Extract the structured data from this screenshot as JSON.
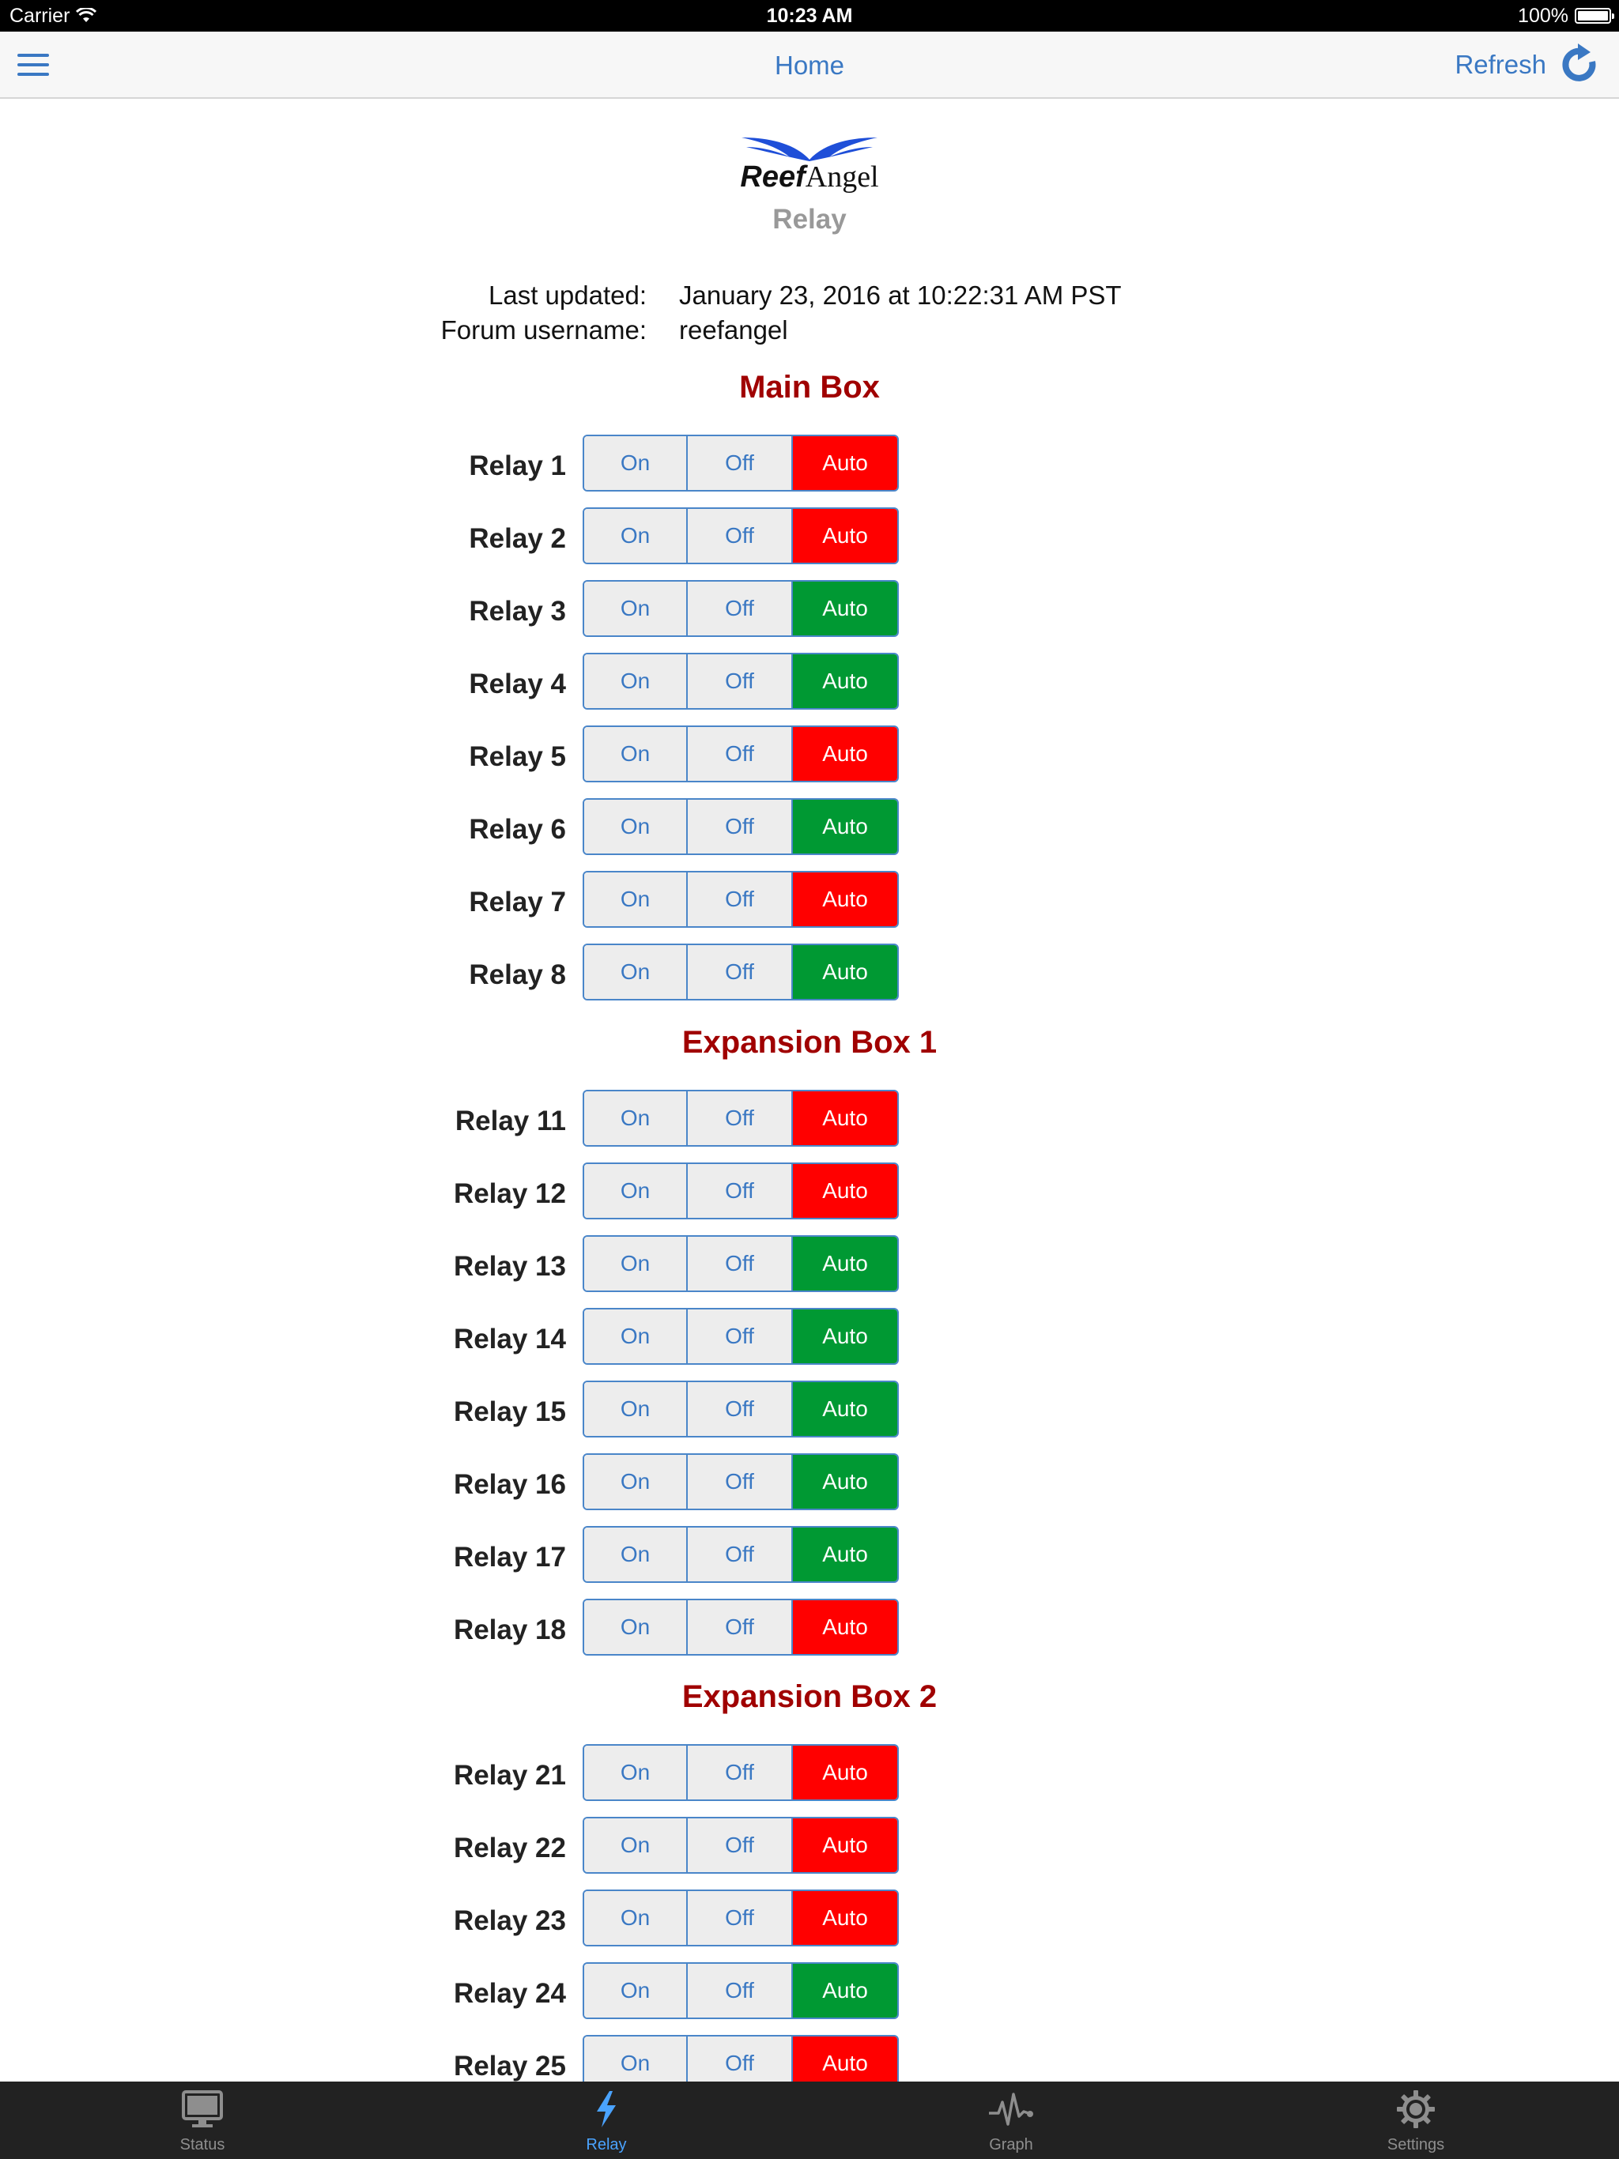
{
  "status_bar": {
    "carrier": "Carrier",
    "time": "10:23 AM",
    "battery": "100%"
  },
  "nav": {
    "title": "Home",
    "refresh_label": "Refresh"
  },
  "logo": {
    "bold": "Reef",
    "regular": "Angel"
  },
  "page": {
    "subtitle": "Relay"
  },
  "info": {
    "last_updated_label": "Last updated:",
    "last_updated_value": "January 23, 2016 at 10:22:31 AM PST",
    "username_label": "Forum username:",
    "username_value": "reefangel"
  },
  "buttons": {
    "on": "On",
    "off": "Off",
    "auto": "Auto"
  },
  "colors": {
    "auto_red": "#ff0000",
    "auto_green": "#009933",
    "accent": "#3a78c3",
    "section_title": "#a00000"
  },
  "sections": [
    {
      "title": "Main Box",
      "relays": [
        {
          "label": "Relay 1",
          "auto_color": "red"
        },
        {
          "label": "Relay 2",
          "auto_color": "red"
        },
        {
          "label": "Relay 3",
          "auto_color": "green"
        },
        {
          "label": "Relay 4",
          "auto_color": "green"
        },
        {
          "label": "Relay 5",
          "auto_color": "red"
        },
        {
          "label": "Relay 6",
          "auto_color": "green"
        },
        {
          "label": "Relay 7",
          "auto_color": "red"
        },
        {
          "label": "Relay 8",
          "auto_color": "green"
        }
      ]
    },
    {
      "title": "Expansion Box 1",
      "relays": [
        {
          "label": "Relay 11",
          "auto_color": "red"
        },
        {
          "label": "Relay 12",
          "auto_color": "red"
        },
        {
          "label": "Relay 13",
          "auto_color": "green"
        },
        {
          "label": "Relay 14",
          "auto_color": "green"
        },
        {
          "label": "Relay 15",
          "auto_color": "green"
        },
        {
          "label": "Relay 16",
          "auto_color": "green"
        },
        {
          "label": "Relay 17",
          "auto_color": "green"
        },
        {
          "label": "Relay 18",
          "auto_color": "red"
        }
      ]
    },
    {
      "title": "Expansion Box 2",
      "relays": [
        {
          "label": "Relay 21",
          "auto_color": "red"
        },
        {
          "label": "Relay 22",
          "auto_color": "red"
        },
        {
          "label": "Relay 23",
          "auto_color": "red"
        },
        {
          "label": "Relay 24",
          "auto_color": "green"
        },
        {
          "label": "Relay 25",
          "auto_color": "red"
        }
      ]
    }
  ],
  "tabs": [
    {
      "label": "Status",
      "icon": "monitor-icon",
      "active": false
    },
    {
      "label": "Relay",
      "icon": "lightning-icon",
      "active": true
    },
    {
      "label": "Graph",
      "icon": "pulse-graph-icon",
      "active": false
    },
    {
      "label": "Settings",
      "icon": "gear-icon",
      "active": false
    }
  ]
}
